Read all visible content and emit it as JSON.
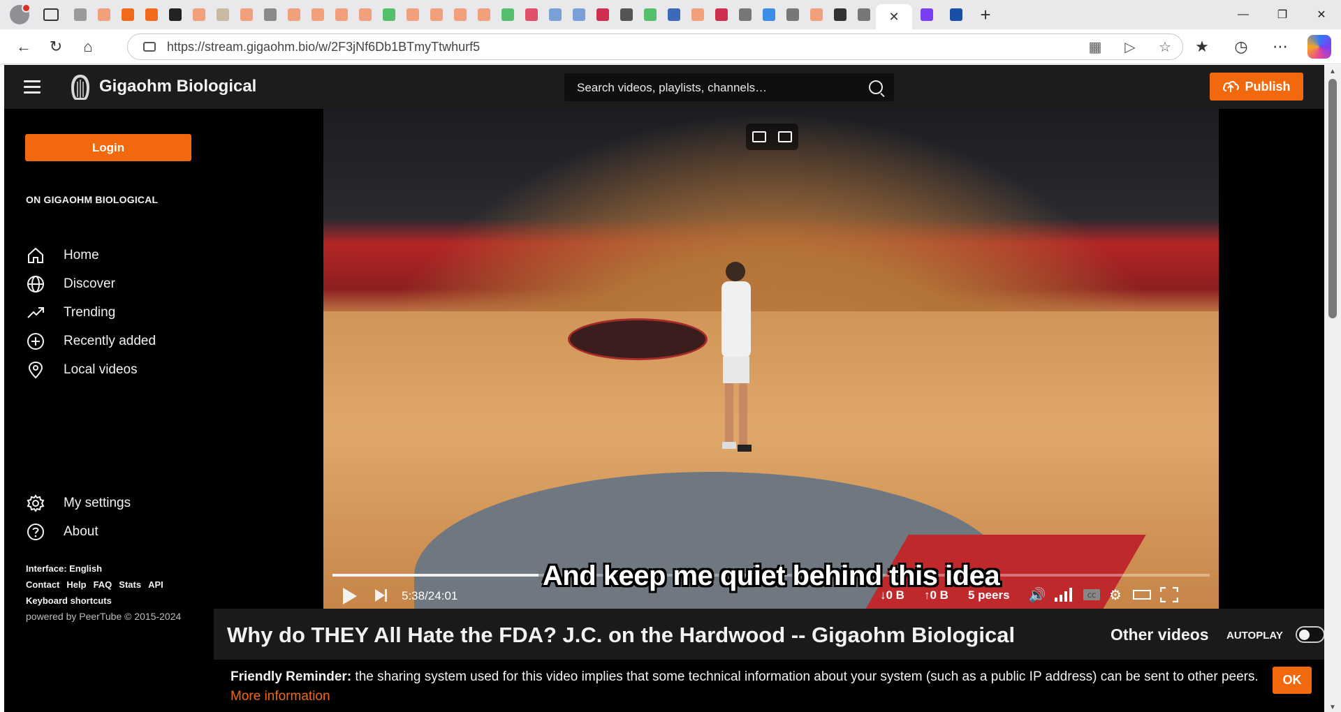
{
  "browser": {
    "active_tab_close": "✕",
    "new_tab": "+",
    "url": "https://stream.gigaohm.bio/w/2F3jNf6Db1BTmyTtwhurf5",
    "favicon_colors": [
      "#9a9a9a",
      "#f2a07b",
      "#f26a1b",
      "#f26a1b",
      "#222222",
      "#f2a07b",
      "#c9b9a0",
      "#f2a07b",
      "#8a8a8a",
      "#f2a07b",
      "#f2a07b",
      "#f2a07b",
      "#f2a07b",
      "#55c06b",
      "#f2a07b",
      "#f2a07b",
      "#f2a07b",
      "#f2a07b",
      "#55c06b",
      "#e0506a",
      "#7aa0d8",
      "#7aa0d8",
      "#d03050",
      "#555555",
      "#55c06b",
      "#3a6ab8",
      "#f2a07b",
      "#d03050",
      "#777777",
      "#3a8ee8",
      "#777777",
      "#f2a07b",
      "#333333",
      "#777777"
    ],
    "extra_tab_colors": [
      "#7b3ff2",
      "#1a4fa8"
    ]
  },
  "header": {
    "brand": "Gigaohm Biological",
    "search_placeholder": "Search videos, playlists, channels…",
    "publish_label": "Publish"
  },
  "sidebar": {
    "login_label": "Login",
    "section_title": "ON GIGAOHM BIOLOGICAL",
    "items": [
      {
        "label": "Home",
        "icon": "home-icon"
      },
      {
        "label": "Discover",
        "icon": "globe-icon"
      },
      {
        "label": "Trending",
        "icon": "trending-icon"
      },
      {
        "label": "Recently added",
        "icon": "plus-circle-icon"
      },
      {
        "label": "Local videos",
        "icon": "location-icon"
      }
    ],
    "bottom_items": [
      {
        "label": "My settings",
        "icon": "gear-icon"
      },
      {
        "label": "About",
        "icon": "help-icon"
      }
    ],
    "interface": "Interface: English",
    "links": [
      "Contact",
      "Help",
      "FAQ",
      "Stats",
      "API"
    ],
    "keyboard": "Keyboard shortcuts",
    "powered": "powered by PeerTube © 2015-2024"
  },
  "player": {
    "subtitle": "And keep me quiet behind this idea",
    "time": "5:38/24:01",
    "progress": 0.235,
    "down": "↓0 B",
    "up": "↑0 B",
    "peers": "5 peers"
  },
  "video": {
    "title": "Why do THEY All Hate the FDA? J.C. on the Hardwood -- Gigaohm Biological",
    "other_videos": "Other videos",
    "autoplay": "AUTOPLAY"
  },
  "reminder": {
    "lead": "Friendly Reminder:",
    "text": " the sharing system used for this video implies that some technical information about your system (such as a public IP address) can be sent to other peers.",
    "more": "More information",
    "ok": "OK"
  }
}
